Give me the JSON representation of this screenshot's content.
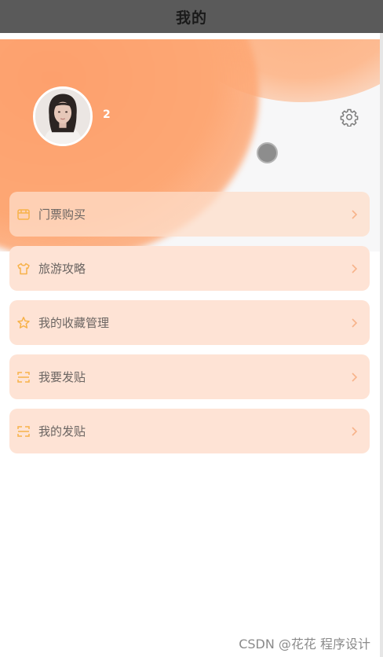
{
  "nav": {
    "title": "我的"
  },
  "profile": {
    "username": "2"
  },
  "icons": {
    "settings": "gear-icon",
    "avatar": "profile-photo",
    "chevron": "chevron-right-icon"
  },
  "colors": {
    "accent": "#fda774",
    "card_bg": "#fee3d5",
    "icon_orange": "#f7b24a",
    "chevron": "#f7b38a",
    "nav_bg": "#5a5a5a"
  },
  "menu": {
    "items": [
      {
        "label": "门票购买",
        "icon": "ticket-icon"
      },
      {
        "label": "旅游攻略",
        "icon": "shirt-icon"
      },
      {
        "label": "我的收藏管理",
        "icon": "star-icon"
      },
      {
        "label": "我要发贴",
        "icon": "post-icon"
      },
      {
        "label": "我的发贴",
        "icon": "post-icon"
      }
    ]
  },
  "watermark": "CSDN @花花 程序设计"
}
